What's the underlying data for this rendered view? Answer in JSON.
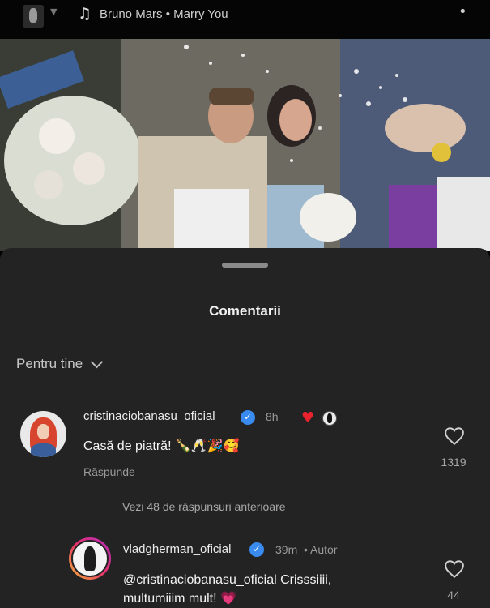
{
  "music": {
    "song": "Bruno Mars • Marry You",
    "icon": "music-note-icon"
  },
  "sheet": {
    "title": "Comentarii",
    "filter_label": "Pentru tine"
  },
  "comments": [
    {
      "username": "cristinaciobanasu_oficial",
      "time": "8h",
      "text": "Casă de piatră! 🍾🥂🎉🥰",
      "reply_label": "Răspunde",
      "like_count": "1319"
    }
  ],
  "view_replies": "Vezi 48 de răspunsuri anterioare",
  "replies": [
    {
      "username": "vladgherman_oficial",
      "time": "39m",
      "author_tag": "• Autor",
      "text_line1": "@cristinaciobanasu_oficial Crisssiiii,",
      "text_line2": "multumiiim mult! 💗",
      "like_count": "44"
    }
  ],
  "colors": {
    "verified": "#3a8bf0",
    "heart": "#e8232e",
    "sheet_bg": "#232323"
  }
}
